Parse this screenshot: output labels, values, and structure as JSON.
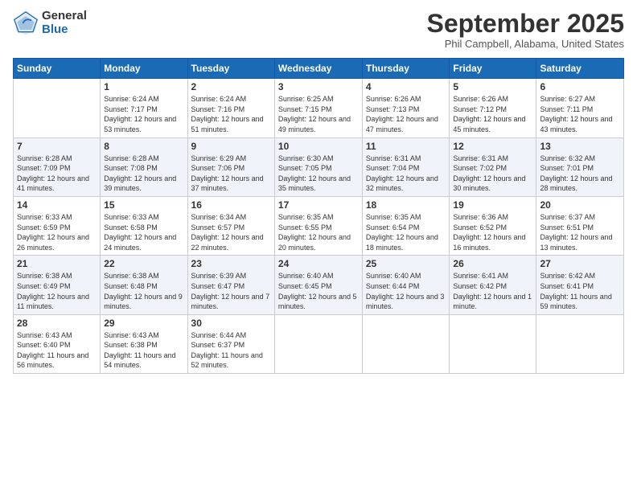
{
  "logo": {
    "general": "General",
    "blue": "Blue"
  },
  "header": {
    "month": "September 2025",
    "location": "Phil Campbell, Alabama, United States"
  },
  "weekdays": [
    "Sunday",
    "Monday",
    "Tuesday",
    "Wednesday",
    "Thursday",
    "Friday",
    "Saturday"
  ],
  "weeks": [
    [
      {
        "day": "",
        "sunrise": "",
        "sunset": "",
        "daylight": ""
      },
      {
        "day": "1",
        "sunrise": "Sunrise: 6:24 AM",
        "sunset": "Sunset: 7:17 PM",
        "daylight": "Daylight: 12 hours and 53 minutes."
      },
      {
        "day": "2",
        "sunrise": "Sunrise: 6:24 AM",
        "sunset": "Sunset: 7:16 PM",
        "daylight": "Daylight: 12 hours and 51 minutes."
      },
      {
        "day": "3",
        "sunrise": "Sunrise: 6:25 AM",
        "sunset": "Sunset: 7:15 PM",
        "daylight": "Daylight: 12 hours and 49 minutes."
      },
      {
        "day": "4",
        "sunrise": "Sunrise: 6:26 AM",
        "sunset": "Sunset: 7:13 PM",
        "daylight": "Daylight: 12 hours and 47 minutes."
      },
      {
        "day": "5",
        "sunrise": "Sunrise: 6:26 AM",
        "sunset": "Sunset: 7:12 PM",
        "daylight": "Daylight: 12 hours and 45 minutes."
      },
      {
        "day": "6",
        "sunrise": "Sunrise: 6:27 AM",
        "sunset": "Sunset: 7:11 PM",
        "daylight": "Daylight: 12 hours and 43 minutes."
      }
    ],
    [
      {
        "day": "7",
        "sunrise": "Sunrise: 6:28 AM",
        "sunset": "Sunset: 7:09 PM",
        "daylight": "Daylight: 12 hours and 41 minutes."
      },
      {
        "day": "8",
        "sunrise": "Sunrise: 6:28 AM",
        "sunset": "Sunset: 7:08 PM",
        "daylight": "Daylight: 12 hours and 39 minutes."
      },
      {
        "day": "9",
        "sunrise": "Sunrise: 6:29 AM",
        "sunset": "Sunset: 7:06 PM",
        "daylight": "Daylight: 12 hours and 37 minutes."
      },
      {
        "day": "10",
        "sunrise": "Sunrise: 6:30 AM",
        "sunset": "Sunset: 7:05 PM",
        "daylight": "Daylight: 12 hours and 35 minutes."
      },
      {
        "day": "11",
        "sunrise": "Sunrise: 6:31 AM",
        "sunset": "Sunset: 7:04 PM",
        "daylight": "Daylight: 12 hours and 32 minutes."
      },
      {
        "day": "12",
        "sunrise": "Sunrise: 6:31 AM",
        "sunset": "Sunset: 7:02 PM",
        "daylight": "Daylight: 12 hours and 30 minutes."
      },
      {
        "day": "13",
        "sunrise": "Sunrise: 6:32 AM",
        "sunset": "Sunset: 7:01 PM",
        "daylight": "Daylight: 12 hours and 28 minutes."
      }
    ],
    [
      {
        "day": "14",
        "sunrise": "Sunrise: 6:33 AM",
        "sunset": "Sunset: 6:59 PM",
        "daylight": "Daylight: 12 hours and 26 minutes."
      },
      {
        "day": "15",
        "sunrise": "Sunrise: 6:33 AM",
        "sunset": "Sunset: 6:58 PM",
        "daylight": "Daylight: 12 hours and 24 minutes."
      },
      {
        "day": "16",
        "sunrise": "Sunrise: 6:34 AM",
        "sunset": "Sunset: 6:57 PM",
        "daylight": "Daylight: 12 hours and 22 minutes."
      },
      {
        "day": "17",
        "sunrise": "Sunrise: 6:35 AM",
        "sunset": "Sunset: 6:55 PM",
        "daylight": "Daylight: 12 hours and 20 minutes."
      },
      {
        "day": "18",
        "sunrise": "Sunrise: 6:35 AM",
        "sunset": "Sunset: 6:54 PM",
        "daylight": "Daylight: 12 hours and 18 minutes."
      },
      {
        "day": "19",
        "sunrise": "Sunrise: 6:36 AM",
        "sunset": "Sunset: 6:52 PM",
        "daylight": "Daylight: 12 hours and 16 minutes."
      },
      {
        "day": "20",
        "sunrise": "Sunrise: 6:37 AM",
        "sunset": "Sunset: 6:51 PM",
        "daylight": "Daylight: 12 hours and 13 minutes."
      }
    ],
    [
      {
        "day": "21",
        "sunrise": "Sunrise: 6:38 AM",
        "sunset": "Sunset: 6:49 PM",
        "daylight": "Daylight: 12 hours and 11 minutes."
      },
      {
        "day": "22",
        "sunrise": "Sunrise: 6:38 AM",
        "sunset": "Sunset: 6:48 PM",
        "daylight": "Daylight: 12 hours and 9 minutes."
      },
      {
        "day": "23",
        "sunrise": "Sunrise: 6:39 AM",
        "sunset": "Sunset: 6:47 PM",
        "daylight": "Daylight: 12 hours and 7 minutes."
      },
      {
        "day": "24",
        "sunrise": "Sunrise: 6:40 AM",
        "sunset": "Sunset: 6:45 PM",
        "daylight": "Daylight: 12 hours and 5 minutes."
      },
      {
        "day": "25",
        "sunrise": "Sunrise: 6:40 AM",
        "sunset": "Sunset: 6:44 PM",
        "daylight": "Daylight: 12 hours and 3 minutes."
      },
      {
        "day": "26",
        "sunrise": "Sunrise: 6:41 AM",
        "sunset": "Sunset: 6:42 PM",
        "daylight": "Daylight: 12 hours and 1 minute."
      },
      {
        "day": "27",
        "sunrise": "Sunrise: 6:42 AM",
        "sunset": "Sunset: 6:41 PM",
        "daylight": "Daylight: 11 hours and 59 minutes."
      }
    ],
    [
      {
        "day": "28",
        "sunrise": "Sunrise: 6:43 AM",
        "sunset": "Sunset: 6:40 PM",
        "daylight": "Daylight: 11 hours and 56 minutes."
      },
      {
        "day": "29",
        "sunrise": "Sunrise: 6:43 AM",
        "sunset": "Sunset: 6:38 PM",
        "daylight": "Daylight: 11 hours and 54 minutes."
      },
      {
        "day": "30",
        "sunrise": "Sunrise: 6:44 AM",
        "sunset": "Sunset: 6:37 PM",
        "daylight": "Daylight: 11 hours and 52 minutes."
      },
      {
        "day": "",
        "sunrise": "",
        "sunset": "",
        "daylight": ""
      },
      {
        "day": "",
        "sunrise": "",
        "sunset": "",
        "daylight": ""
      },
      {
        "day": "",
        "sunrise": "",
        "sunset": "",
        "daylight": ""
      },
      {
        "day": "",
        "sunrise": "",
        "sunset": "",
        "daylight": ""
      }
    ]
  ]
}
